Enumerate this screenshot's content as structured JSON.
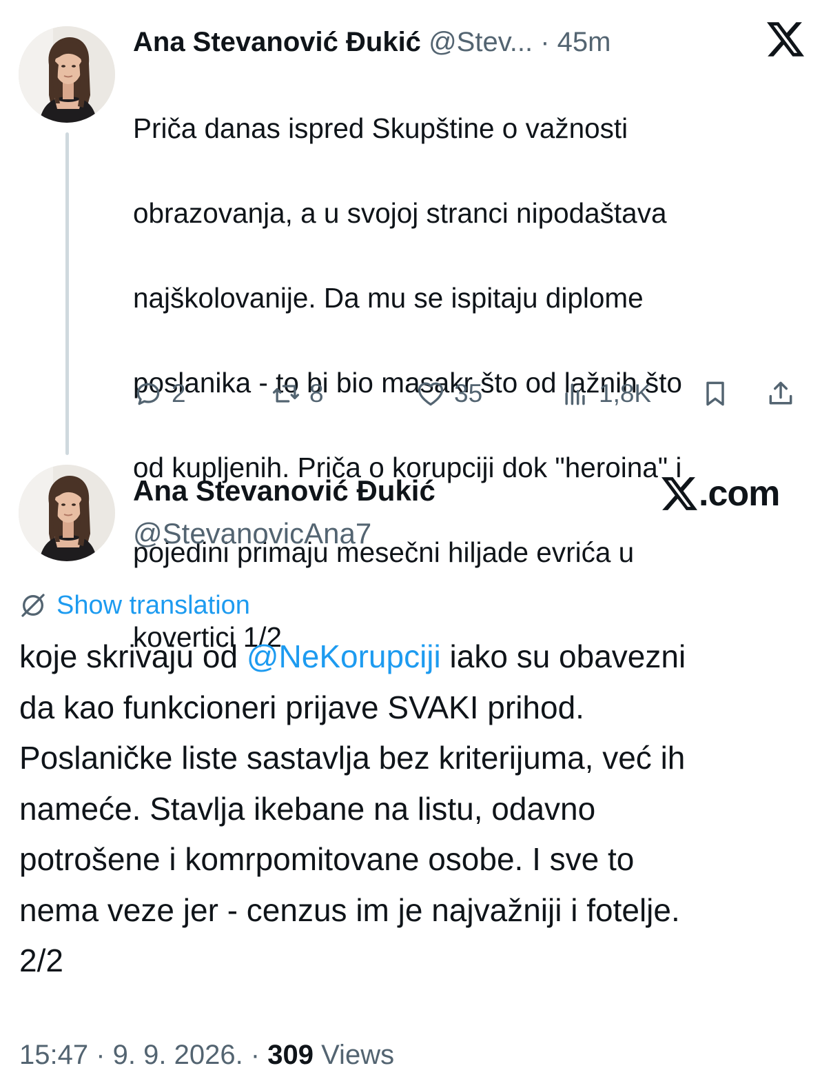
{
  "tweet1": {
    "author_name": "Ana Stevanović Đukić",
    "author_handle": "@Stev...",
    "time": "· 45m",
    "text_lines": [
      "Priča danas ispred Skupštine o važnosti",
      "obrazovanja, a u svojoj stranci nipodaštava",
      "najškolovanije. Da mu se ispitaju diplome",
      "poslanika - to bi bio masakr što od lažnih što",
      "od kupljenih. Priča o korupciji dok \"heroina\" i",
      "pojedini primaju mesečni hiljade evrića u",
      "kovertici 1/2"
    ],
    "actions": {
      "replies": "2",
      "reposts": "8",
      "likes": "35",
      "views": "1,8K"
    }
  },
  "tweet2": {
    "author_name": "Ana Stevanović Đukić",
    "author_handle": "@StevanovicAna7",
    "brand": ".com",
    "translate_label": "Show translation",
    "text_before_mention": "koje skrivaju od ",
    "mention": "@NeKorupciji",
    "text_after_mention": " iako su obavezni\nda kao funkcioneri prijave SVAKI prihod.\nPoslaničke liste sastavlja bez kriterijuma, već ih\nnameće. Stavlja ikebane na listu, odavno\npotrošene i komrpomitovane osobe. I sve to\nnema veze jer - cenzus im je najvažniji i fotelje.\n2/2",
    "timestamp": "15:47 · 9. 9. 2026. · ",
    "views_count": "309",
    "views_label": " Views"
  },
  "colors": {
    "accent": "#1d9bf0",
    "text": "#0f1419",
    "muted": "#536471",
    "thread_line": "#cfd9de"
  },
  "icons": [
    "reply-icon",
    "repost-icon",
    "like-icon",
    "views-icon",
    "bookmark-icon",
    "share-icon",
    "x-logo-icon",
    "translate-icon"
  ]
}
